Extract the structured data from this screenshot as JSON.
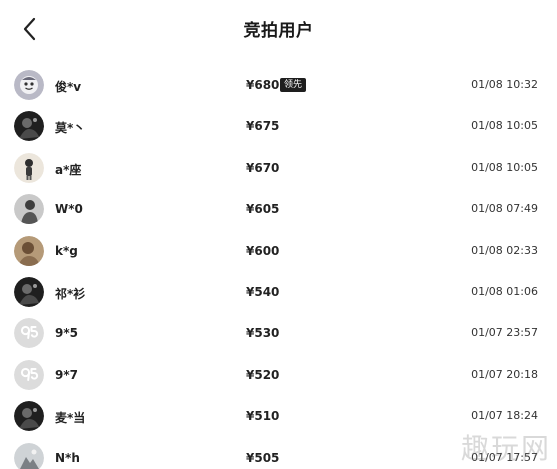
{
  "header": {
    "title": "竞拍用户"
  },
  "badge_label": "领先",
  "bids": [
    {
      "nick": "俊*v",
      "price": "¥680",
      "time": "01/08 10:32",
      "avatar": "cartoon-face",
      "leading": true
    },
    {
      "nick": "莫*丶",
      "price": "¥675",
      "time": "01/08 10:05",
      "avatar": "dark-photo",
      "leading": false
    },
    {
      "nick": "a*座",
      "price": "¥670",
      "time": "01/08 10:05",
      "avatar": "figure-photo",
      "leading": false
    },
    {
      "nick": "W*0",
      "price": "¥605",
      "time": "01/08 07:49",
      "avatar": "gray-photo",
      "leading": false
    },
    {
      "nick": "k*g",
      "price": "¥600",
      "time": "01/08 02:33",
      "avatar": "brown-photo",
      "leading": false
    },
    {
      "nick": "祁*衫",
      "price": "¥540",
      "time": "01/08 01:06",
      "avatar": "dark-photo",
      "leading": false
    },
    {
      "nick": "9*5",
      "price": "¥530",
      "time": "01/07 23:57",
      "avatar": "default-logo",
      "leading": false
    },
    {
      "nick": "9*7",
      "price": "¥520",
      "time": "01/07 20:18",
      "avatar": "default-logo",
      "leading": false
    },
    {
      "nick": "麦*当",
      "price": "¥510",
      "time": "01/07 18:24",
      "avatar": "dark-photo",
      "leading": false
    },
    {
      "nick": "N*h",
      "price": "¥505",
      "time": "01/07 17:57",
      "avatar": "light-photo",
      "leading": false
    }
  ],
  "watermark": "趣玩网",
  "colors": {
    "badge_bg": "#1e1e1e",
    "text": "#222222",
    "default_avatar": "#d8d8d8"
  }
}
